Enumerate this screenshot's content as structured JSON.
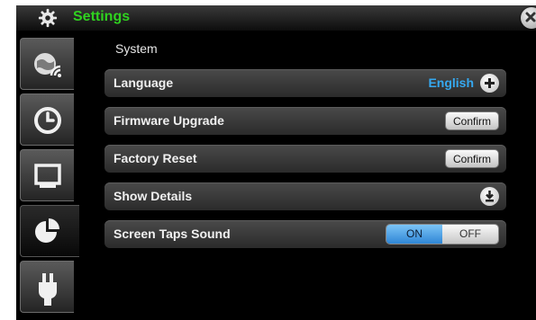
{
  "window": {
    "title": "Settings",
    "title_icon": "gear-icon",
    "close_icon": "close-icon",
    "title_color": "#2fd11f"
  },
  "sidebar": {
    "tabs": [
      {
        "icon": "network-globe-icon",
        "active": false
      },
      {
        "icon": "clock-icon",
        "active": false
      },
      {
        "icon": "display-icon",
        "active": false
      },
      {
        "icon": "pie-chart-icon",
        "active": true
      },
      {
        "icon": "power-plug-icon",
        "active": false
      }
    ]
  },
  "main": {
    "section_title": "System",
    "rows": {
      "language": {
        "label": "Language",
        "value": "English",
        "icon": "plus-icon"
      },
      "firmware": {
        "label": "Firmware Upgrade",
        "button": "Confirm"
      },
      "factory_reset": {
        "label": "Factory Reset",
        "button": "Confirm"
      },
      "show_details": {
        "label": "Show Details",
        "icon": "expand-down-icon"
      },
      "screen_taps": {
        "label": "Screen Taps Sound",
        "on_label": "ON",
        "off_label": "OFF",
        "state": "ON"
      }
    }
  },
  "colors": {
    "accent_blue": "#35a8f0",
    "toggle_on": "#2f86d6"
  }
}
